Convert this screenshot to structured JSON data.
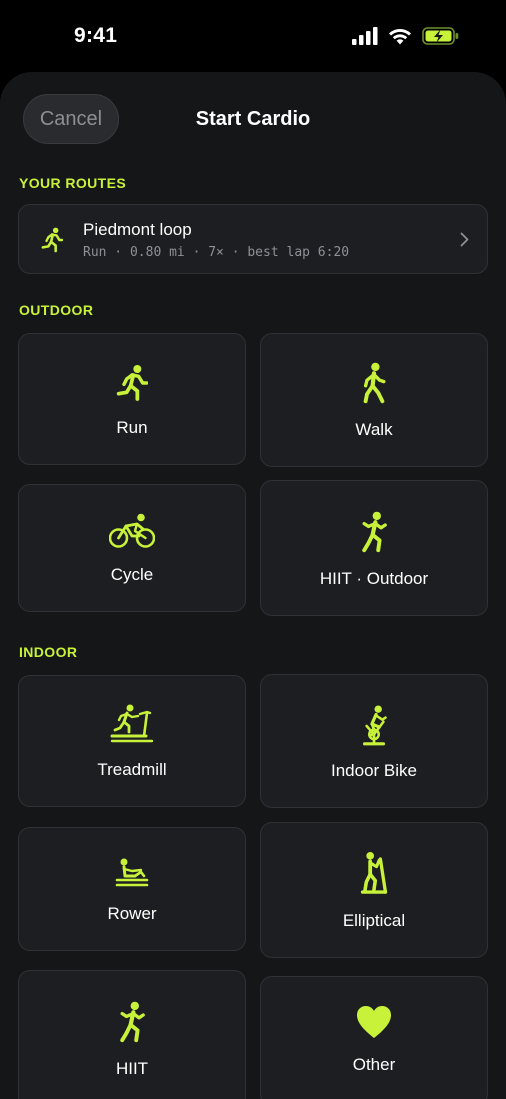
{
  "status_bar": {
    "time": "9:41"
  },
  "header": {
    "cancel_label": "Cancel",
    "title": "Start Cardio"
  },
  "accent_color": "#c8f23a",
  "sections": {
    "routes": {
      "label": "YOUR ROUTES",
      "items": [
        {
          "name": "Piedmont loop",
          "meta": "Run · 0.80 mi · 7× · best lap 6:20",
          "icon": "run-icon"
        }
      ]
    },
    "outdoor": {
      "label": "OUTDOOR",
      "items": [
        {
          "label": "Run",
          "icon": "run-icon"
        },
        {
          "label": "Walk",
          "icon": "walk-icon"
        },
        {
          "label": "Cycle",
          "icon": "cycle-icon"
        },
        {
          "label": "HIIT · Outdoor",
          "icon": "hiit-icon"
        }
      ]
    },
    "indoor": {
      "label": "INDOOR",
      "items": [
        {
          "label": "Treadmill",
          "icon": "treadmill-icon"
        },
        {
          "label": "Indoor Bike",
          "icon": "indoor-bike-icon"
        },
        {
          "label": "Rower",
          "icon": "rower-icon"
        },
        {
          "label": "Elliptical",
          "icon": "elliptical-icon"
        },
        {
          "label": "HIIT",
          "icon": "hiit-icon"
        },
        {
          "label": "Other",
          "icon": "heart-icon"
        }
      ]
    }
  }
}
